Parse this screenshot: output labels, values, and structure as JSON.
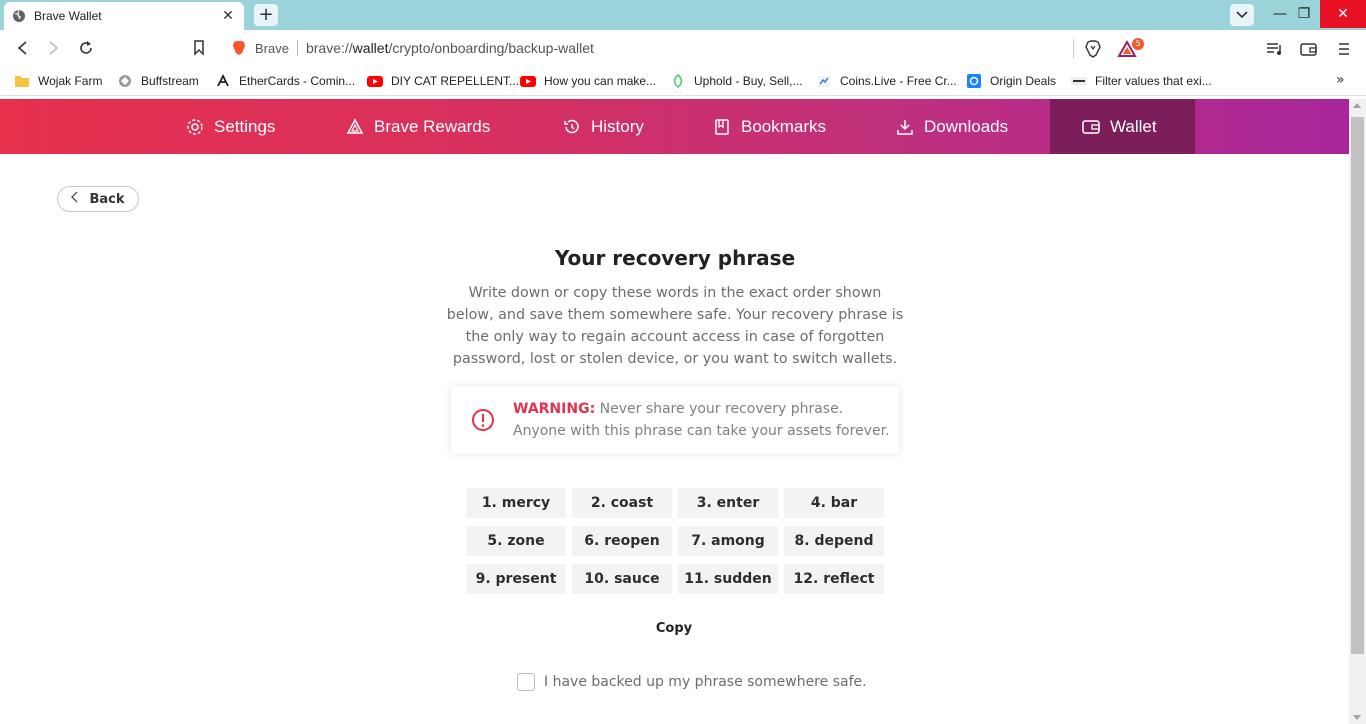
{
  "window": {
    "tab_title": "Brave Wallet",
    "tab_close": "✕",
    "new_tab": "+",
    "minimize": "—",
    "restore": "❐",
    "close": "✕"
  },
  "omnibox": {
    "site_label": "Brave",
    "url_prefix": "brave://",
    "url_host": "wallet",
    "url_path": "/crypto/onboarding/backup-wallet",
    "rewards_badge": "5"
  },
  "bookmarks": [
    {
      "label": "Wojak Farm",
      "icon": "folder-icon",
      "color": "#f4c542"
    },
    {
      "label": "Buffstream",
      "icon": "buffstream-icon",
      "color": "#666666"
    },
    {
      "label": "EtherCards - Comin...",
      "icon": "ethercards-icon",
      "color": "#222222"
    },
    {
      "label": "DIY CAT REPELLENT...",
      "icon": "youtube-icon",
      "color": "#ff0000"
    },
    {
      "label": "How you can make...",
      "icon": "youtube-icon",
      "color": "#ff0000"
    },
    {
      "label": "Uphold - Buy, Sell,...",
      "icon": "uphold-icon",
      "color": "#49cc68"
    },
    {
      "label": "Coins.Live - Free Cr...",
      "icon": "coinslive-icon",
      "color": "#3b6fd8"
    },
    {
      "label": "Origin Deals",
      "icon": "origin-icon",
      "color": "#1a82ff"
    },
    {
      "label": "Filter values that exi...",
      "icon": "gdh-icon",
      "color": "#333333"
    }
  ],
  "bookmarks_more": "»",
  "nav": {
    "items": [
      {
        "label": "Settings",
        "icon": "gear-icon"
      },
      {
        "label": "Brave Rewards",
        "icon": "rewards-triangle-icon"
      },
      {
        "label": "History",
        "icon": "history-icon"
      },
      {
        "label": "Bookmarks",
        "icon": "bookmarks-icon"
      },
      {
        "label": "Downloads",
        "icon": "download-icon"
      },
      {
        "label": "Wallet",
        "icon": "wallet-icon",
        "active": true
      }
    ],
    "gradient_start": "#e6304c",
    "gradient_end": "#a8269a",
    "active_color": "#7b1e5a"
  },
  "page": {
    "back_label": "Back",
    "title": "Your recovery phrase",
    "description": "Write down or copy these words in the exact order shown below, and save them somewhere safe. Your recovery phrase is the only way to regain account access in case of forgotten password, lost or stolen device, or you want to switch wallets.",
    "warning_label": "WARNING:",
    "warning_line1": " Never share your recovery phrase.",
    "warning_line2": "Anyone with this phrase can take your assets forever.",
    "warning_color": "#e2324c",
    "words": [
      "1. mercy",
      "2. coast",
      "3. enter",
      "4. bar",
      "5. zone",
      "6. reopen",
      "7. among",
      "8. depend",
      "9. present",
      "10. sauce",
      "11. sudden",
      "12. reflect"
    ],
    "copy_label": "Copy",
    "confirm_label": "I have backed up my phrase somewhere safe.",
    "confirm_checked": false
  }
}
